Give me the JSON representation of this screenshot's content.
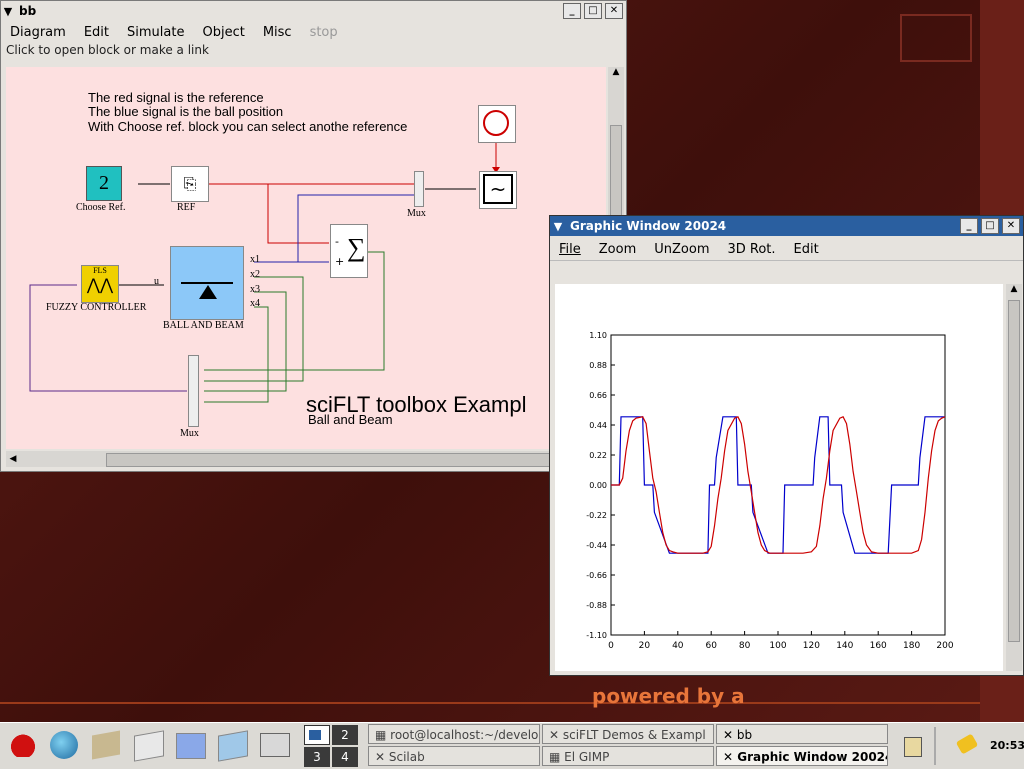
{
  "scicos_window": {
    "title": "bb",
    "menus": [
      "Diagram",
      "Edit",
      "Simulate",
      "Object",
      "Misc",
      "stop"
    ],
    "status": "Click to open block or make a link",
    "notes": [
      "The red signal is the reference",
      "The blue signal is the ball position",
      "With Choose ref. block you can select anothe reference"
    ],
    "blocks": {
      "choose_ref_value": "2",
      "choose_ref": "Choose Ref.",
      "ref": "REF",
      "mux_top": "Mux",
      "fls": "FLS",
      "fuzzy": "FUZZY CONTROLLER",
      "u": "u",
      "ball_beam": "BALL AND BEAM",
      "x1": "x1",
      "x2": "x2",
      "x3": "x3",
      "x4": "x4",
      "sum_minus": "-",
      "sum_plus": "+",
      "mux_bottom": "Mux"
    },
    "heading": "sciFLT toolbox Exampl",
    "subheading": "Ball and Beam"
  },
  "graphic_window": {
    "title": "Graphic Window 20024",
    "menus": [
      "File",
      "Zoom",
      "UnZoom",
      "3D Rot.",
      "Edit"
    ]
  },
  "chart_data": {
    "type": "line",
    "xlim": [
      0,
      200
    ],
    "ylim": [
      -1.1,
      1.1
    ],
    "x_ticks": [
      "0",
      "20",
      "40",
      "60",
      "80",
      "100",
      "120",
      "140",
      "160",
      "180",
      "200"
    ],
    "y_ticks": [
      "1.10",
      "0.88",
      "0.66",
      "0.44",
      "0.22",
      "0.00",
      "-0.22",
      "-0.44",
      "-0.66",
      "-0.88",
      "-1.10"
    ],
    "grid": false,
    "series": [
      {
        "color": "#0000cc",
        "x": [
          0,
          5,
          6,
          13,
          14,
          19,
          20,
          25,
          26,
          35,
          36,
          58,
          59,
          62,
          63,
          67,
          68,
          75,
          76,
          84,
          85,
          94,
          95,
          103,
          104,
          121,
          122,
          125,
          126,
          130,
          131,
          138,
          139,
          146,
          147,
          156,
          157,
          166,
          168,
          184,
          185,
          188,
          189,
          193,
          194,
          200
        ],
        "y": [
          0,
          0,
          0.5,
          0.5,
          0.5,
          0.5,
          0,
          0,
          -0.2,
          -0.5,
          -0.5,
          -0.5,
          0,
          0,
          0.2,
          0.5,
          0.5,
          0.5,
          0,
          0,
          -0.2,
          -0.5,
          -0.5,
          -0.5,
          0,
          0,
          0.2,
          0.5,
          0.5,
          0.5,
          0,
          0,
          -0.2,
          -0.5,
          -0.5,
          -0.5,
          -0.5,
          -0.5,
          0,
          0,
          0.2,
          0.5,
          0.5,
          0.5,
          0.5,
          0.5
        ]
      },
      {
        "color": "#cc0000",
        "x": [
          0,
          5,
          7,
          9,
          11,
          13,
          15,
          19,
          21,
          23,
          25,
          27,
          29,
          31,
          33,
          35,
          37,
          40,
          55,
          58,
          60,
          62,
          64,
          66,
          68,
          70,
          74,
          76,
          78,
          80,
          82,
          84,
          86,
          88,
          90,
          92,
          95,
          100,
          115,
          120,
          123,
          125,
          127,
          129,
          131,
          133,
          137,
          139,
          141,
          143,
          145,
          147,
          149,
          151,
          153,
          156,
          160,
          180,
          184,
          186,
          188,
          190,
          192,
          194,
          196,
          198,
          200
        ],
        "y": [
          0,
          0,
          0.05,
          0.25,
          0.4,
          0.47,
          0.49,
          0.5,
          0.45,
          0.25,
          0.05,
          -0.05,
          -0.2,
          -0.35,
          -0.44,
          -0.48,
          -0.49,
          -0.5,
          -0.5,
          -0.49,
          -0.45,
          -0.3,
          -0.1,
          0.05,
          0.25,
          0.4,
          0.49,
          0.5,
          0.45,
          0.3,
          0.1,
          -0.05,
          -0.2,
          -0.35,
          -0.44,
          -0.48,
          -0.5,
          -0.5,
          -0.5,
          -0.49,
          -0.45,
          -0.3,
          -0.1,
          0.05,
          0.25,
          0.4,
          0.49,
          0.5,
          0.45,
          0.3,
          0.1,
          -0.05,
          -0.2,
          -0.35,
          -0.44,
          -0.49,
          -0.5,
          -0.5,
          -0.48,
          -0.4,
          -0.2,
          0.05,
          0.25,
          0.4,
          0.47,
          0.49,
          0.5
        ]
      }
    ]
  },
  "desktop": {
    "powered": "powered by a"
  },
  "taskbar": {
    "workspaces": [
      "2",
      "3",
      "4"
    ],
    "tasks": [
      {
        "label": "root@localhost:~/develop",
        "active": false
      },
      {
        "label": "sciFLT Demos & Exampl",
        "active": false
      },
      {
        "label": "bb",
        "active": false
      },
      {
        "label": "Scilab",
        "active": false
      },
      {
        "label": "El GIMP",
        "active": false
      },
      {
        "label": "Graphic Window 20024",
        "active": true
      }
    ],
    "clock": "20:53"
  }
}
